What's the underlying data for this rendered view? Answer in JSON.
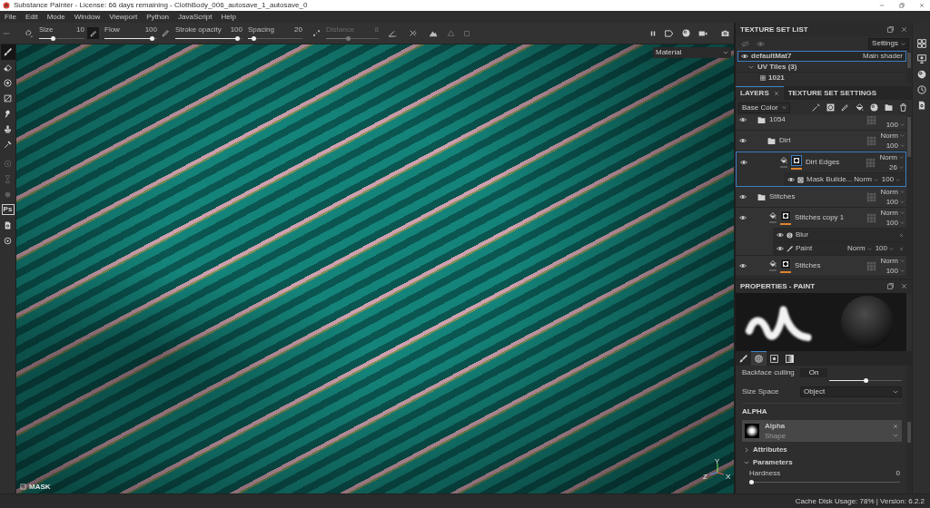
{
  "window": {
    "title": "Substance Painter - License: 66 days remaining - ClothBody_006_autosave_1_autosave_0"
  },
  "menu": [
    "File",
    "Edit",
    "Mode",
    "Window",
    "Viewport",
    "Python",
    "JavaScript",
    "Help"
  ],
  "tool_options": {
    "sliders": [
      {
        "label": "Size",
        "value": "10",
        "level": 0.29,
        "disabled": false
      },
      {
        "label": "Flow",
        "value": "100",
        "level": 0.94,
        "disabled": false
      },
      {
        "label": "Stroke opacity",
        "value": "100",
        "level": 0.95,
        "disabled": false
      },
      {
        "label": "Spacing",
        "value": "20",
        "level": 0.07,
        "disabled": false
      },
      {
        "label": "Distance",
        "value": "8",
        "level": 0.42,
        "disabled": true
      }
    ]
  },
  "tools": [
    {
      "kind": "brush",
      "selected": true,
      "disabled": false
    },
    {
      "kind": "eraser",
      "selected": false,
      "disabled": false
    },
    {
      "kind": "projection",
      "selected": false,
      "disabled": false
    },
    {
      "kind": "polygon",
      "selected": false,
      "disabled": false
    },
    {
      "kind": "smudge",
      "selected": false,
      "disabled": false
    },
    {
      "kind": "clone",
      "selected": false,
      "disabled": false
    },
    {
      "kind": "picker",
      "selected": false,
      "disabled": false
    },
    {
      "kind": "bake",
      "selected": false,
      "disabled": true
    },
    {
      "kind": "hourglass",
      "selected": false,
      "disabled": true
    },
    {
      "kind": "dot",
      "selected": false,
      "disabled": true
    },
    {
      "kind": "ps",
      "label": "Ps",
      "selected": false,
      "disabled": false
    },
    {
      "kind": "document",
      "selected": false,
      "disabled": false
    },
    {
      "kind": "gear",
      "selected": false,
      "disabled": false
    }
  ],
  "viewport": {
    "mode": "Material",
    "mask_label": "MASK",
    "axes": [
      "Y",
      "Z",
      "X"
    ]
  },
  "texture_set_list": {
    "title": "TEXTURE SET LIST",
    "settings": "Settings",
    "sets": [
      {
        "name": "defaultMat7",
        "shader": "Main shader",
        "selected": true,
        "children": [
          {
            "name": "UV Tiles (3)",
            "expanded": true,
            "children": [
              {
                "name": "1021"
              }
            ]
          }
        ]
      }
    ]
  },
  "layers_panel": {
    "tabs": [
      {
        "label": "LAYERS",
        "selected": true,
        "closable": true
      },
      {
        "label": "TEXTURE SET SETTINGS",
        "selected": false,
        "closable": false
      }
    ],
    "channel": "Base Color",
    "layers": [
      {
        "kind": "folder",
        "name": "1054",
        "opacity": "100",
        "visible": true,
        "selected": false,
        "children": [
          {
            "kind": "folder",
            "name": "Dirt",
            "blend": "Norm",
            "opacity": "100",
            "visible": true,
            "selected": false,
            "children": [
              {
                "kind": "fill",
                "name": "Dirt Edges",
                "blend": "Norm",
                "opacity": "26",
                "visible": true,
                "selected": true,
                "effects": [
                  {
                    "kind": "mask",
                    "name": "Mask Builde...",
                    "blend": "Norm",
                    "opacity": "100",
                    "visible": true
                  }
                ]
              }
            ]
          }
        ]
      },
      {
        "kind": "folder",
        "name": "Stitches",
        "blend": "Norm",
        "opacity": "100",
        "visible": true,
        "selected": false,
        "children": [
          {
            "kind": "fill",
            "name": "Stitches copy 1",
            "blend": "Norm",
            "opacity": "100",
            "visible": true,
            "selected": false,
            "effects": [
              {
                "kind": "blur",
                "name": "Blur",
                "visible": true
              },
              {
                "kind": "paint",
                "name": "Paint",
                "blend": "Norm",
                "opacity": "100",
                "visible": true
              }
            ]
          },
          {
            "kind": "fill",
            "name": "Stitches",
            "blend": "Norm",
            "opacity": "100",
            "visible": true,
            "selected": false
          }
        ]
      }
    ]
  },
  "properties": {
    "title": "PROPERTIES - PAINT",
    "tabs": [
      {
        "kind": "brush",
        "selected": false
      },
      {
        "kind": "alpha",
        "selected": true
      },
      {
        "kind": "stencil",
        "selected": false
      },
      {
        "kind": "material",
        "selected": false
      }
    ],
    "settings": [
      {
        "kind": "toggle",
        "label": "Backface culling",
        "value": "On"
      },
      {
        "kind": "slider",
        "level": 0.5
      },
      {
        "kind": "dropdown",
        "label": "Size Space",
        "value": "Object"
      }
    ],
    "alpha": {
      "heading": "ALPHA",
      "name": "Alpha",
      "type": "Shape"
    },
    "sections": [
      {
        "label": "Attributes",
        "expanded": false
      },
      {
        "label": "Parameters",
        "expanded": true,
        "parameters": [
          {
            "label": "Hardness",
            "value": "0",
            "level": 0
          }
        ]
      }
    ]
  },
  "status_bar": {
    "text": "Cache Disk Usage: 78% | Version: 6.2.2"
  }
}
